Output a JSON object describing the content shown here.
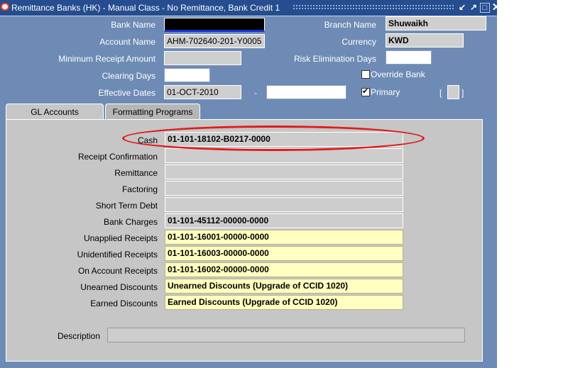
{
  "window": {
    "title": "Remittance Banks (HK) - Manual Class - No Remittance, Bank Credit 1",
    "controls": {
      "minimize": "↙",
      "restore": "↗",
      "maximize": "□",
      "close": "✕"
    }
  },
  "header": {
    "bank_name_label": "Bank Name",
    "account_name_label": "Account Name",
    "account_name_value": "AHM-702640-201-Y0005",
    "min_receipt_label": "Minimum Receipt Amount",
    "clearing_days_label": "Clearing Days",
    "effective_dates_label": "Effective Dates",
    "effective_from": "01-OCT-2010",
    "date_separator": "-",
    "branch_name_label": "Branch Name",
    "branch_name_value": "Shuwaikh",
    "currency_label": "Currency",
    "currency_value": "KWD",
    "risk_days_label": "Risk Elimination Days",
    "override_bank_label": "Override Bank",
    "override_bank_checked": false,
    "primary_label": "Primary",
    "primary_checked": true,
    "bracket_open": "[",
    "bracket_close": "]"
  },
  "tabs": [
    {
      "label": "GL Accounts",
      "active": true
    },
    {
      "label": "Formatting Programs",
      "active": false
    }
  ],
  "gl": {
    "rows": [
      {
        "label": "Cash",
        "value": "01-101-18102-B0217-0000",
        "style": "grey"
      },
      {
        "label": "Receipt Confirmation",
        "value": "",
        "style": "grey"
      },
      {
        "label": "Remittance",
        "value": "",
        "style": "grey"
      },
      {
        "label": "Factoring",
        "value": "",
        "style": "grey"
      },
      {
        "label": "Short Term Debt",
        "value": "",
        "style": "grey"
      },
      {
        "label": "Bank Charges",
        "value": "01-101-45112-00000-0000",
        "style": "grey"
      },
      {
        "label": "Unapplied Receipts",
        "value": "01-101-16001-00000-0000",
        "style": "yellow"
      },
      {
        "label": "Unidentified Receipts",
        "value": "01-101-16003-00000-0000",
        "style": "yellow"
      },
      {
        "label": "On Account Receipts",
        "value": "01-101-16002-00000-0000",
        "style": "yellow"
      },
      {
        "label": "Unearned Discounts",
        "value": "Unearned Discounts (Upgrade of CCID 1020)",
        "style": "yellow"
      },
      {
        "label": "Earned Discounts",
        "value": "Earned Discounts (Upgrade of CCID 1020)",
        "style": "yellow"
      }
    ],
    "description_label": "Description"
  },
  "colors": {
    "window_bg": "#6e8bb5",
    "titlebar": "#254d8f",
    "panel": "#c6c6c6",
    "required_field": "#ffffbf",
    "highlight": "#e01b1b"
  }
}
